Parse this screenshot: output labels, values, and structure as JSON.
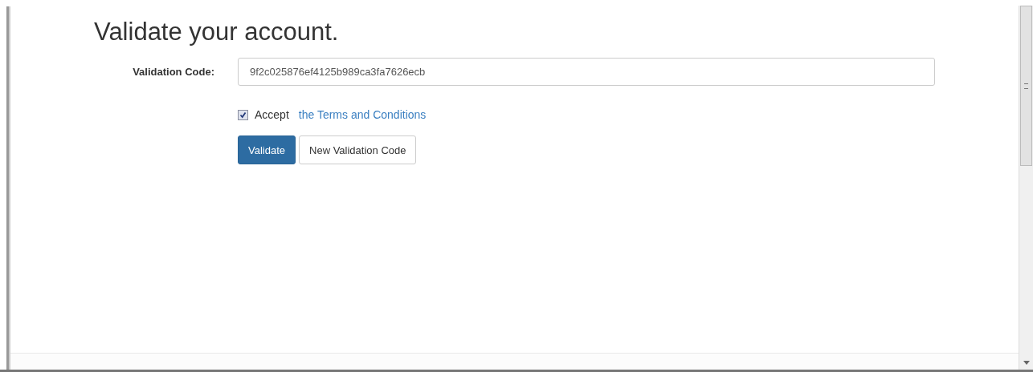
{
  "heading": "Validate your account.",
  "form": {
    "label": "Validation Code:",
    "value": "9f2c025876ef4125b989ca3fa7626ecb"
  },
  "terms": {
    "checked": true,
    "label": "Accept",
    "link": "the Terms and Conditions"
  },
  "buttons": [
    {
      "label": "Validate",
      "kind": "primary"
    },
    {
      "label": "New Validation Code",
      "kind": "default"
    }
  ]
}
